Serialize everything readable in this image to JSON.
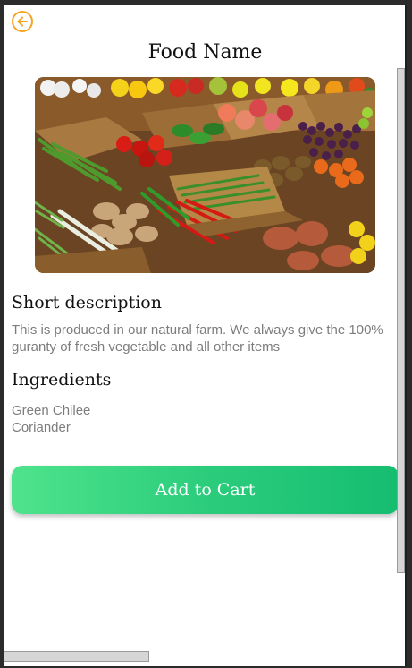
{
  "header": {
    "title": "Food Name",
    "back_icon": "arrow-left-circle-icon",
    "accent_color": "#f5a623"
  },
  "hero_image": {
    "alt": "Assorted fresh vegetables and fruits in baskets"
  },
  "short_description": {
    "heading": "Short description",
    "text": "This is produced in our natural farm. We always give the 100% guranty of fresh vegetable and all other items"
  },
  "ingredients": {
    "heading": "Ingredients",
    "items": [
      "Green Chilee",
      "Coriander"
    ]
  },
  "cart_button": {
    "label": "Add to Cart",
    "gradient_start": "#4fe38c",
    "gradient_end": "#16bd70"
  }
}
